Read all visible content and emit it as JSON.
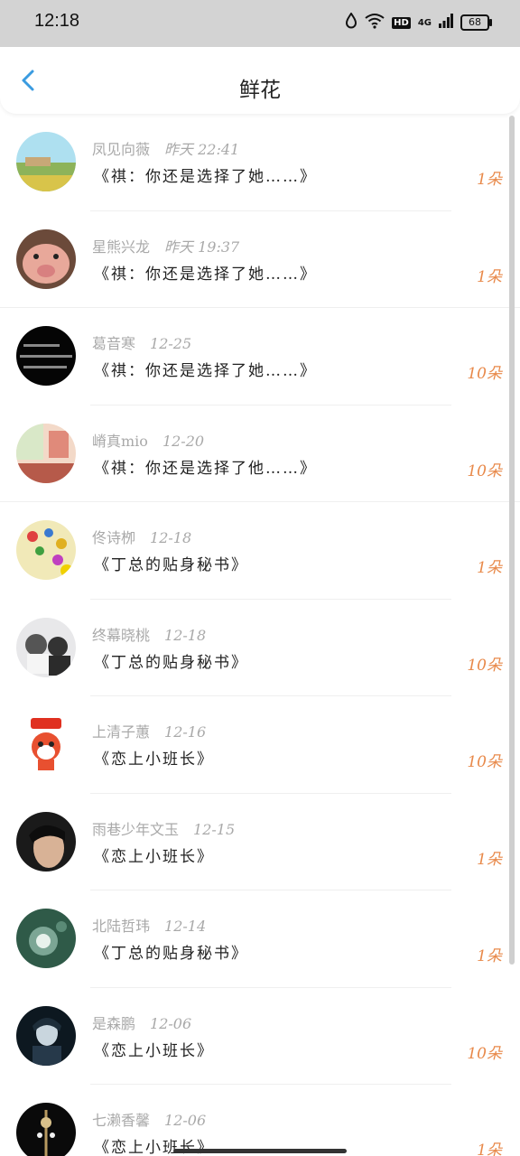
{
  "status_bar": {
    "time": "12:18",
    "network": "4G",
    "hd": "HD",
    "battery": "68"
  },
  "header": {
    "title": "鲜花"
  },
  "colors": {
    "accent_back": "#3a9be0",
    "count_orange": "#e8894a",
    "meta_gray": "#a9a9a9"
  },
  "items": [
    {
      "name": "凤见向薇",
      "time": "昨天 22:41",
      "book": "《祺：你还是选择了她……》",
      "count": "1朵"
    },
    {
      "name": "星熊兴龙",
      "time": "昨天 19:37",
      "book": "《祺：你还是选择了她……》",
      "count": "1朵"
    },
    {
      "name": "葛音寒",
      "time": "12-25",
      "book": "《祺：你还是选择了她……》",
      "count": "10朵"
    },
    {
      "name": "嵴真mio",
      "time": "12-20",
      "book": "《祺：你还是选择了他……》",
      "count": "10朵"
    },
    {
      "name": "佟诗栁",
      "time": "12-18",
      "book": "《丁总的贴身秘书》",
      "count": "1朵"
    },
    {
      "name": "终幕晓桃",
      "time": "12-18",
      "book": "《丁总的贴身秘书》",
      "count": "10朵"
    },
    {
      "name": "上清子蕙",
      "time": "12-16",
      "book": "《恋上小班长》",
      "count": "10朵"
    },
    {
      "name": "雨巷少年文玉",
      "time": "12-15",
      "book": "《恋上小班长》",
      "count": "1朵"
    },
    {
      "name": "北陆哲玮",
      "time": "12-14",
      "book": "《丁总的贴身秘书》",
      "count": "1朵"
    },
    {
      "name": "是森鹏",
      "time": "12-06",
      "book": "《恋上小班长》",
      "count": "10朵"
    },
    {
      "name": "七濑香馨",
      "time": "12-06",
      "book": "《恋上小班长》",
      "count": "1朵"
    }
  ]
}
